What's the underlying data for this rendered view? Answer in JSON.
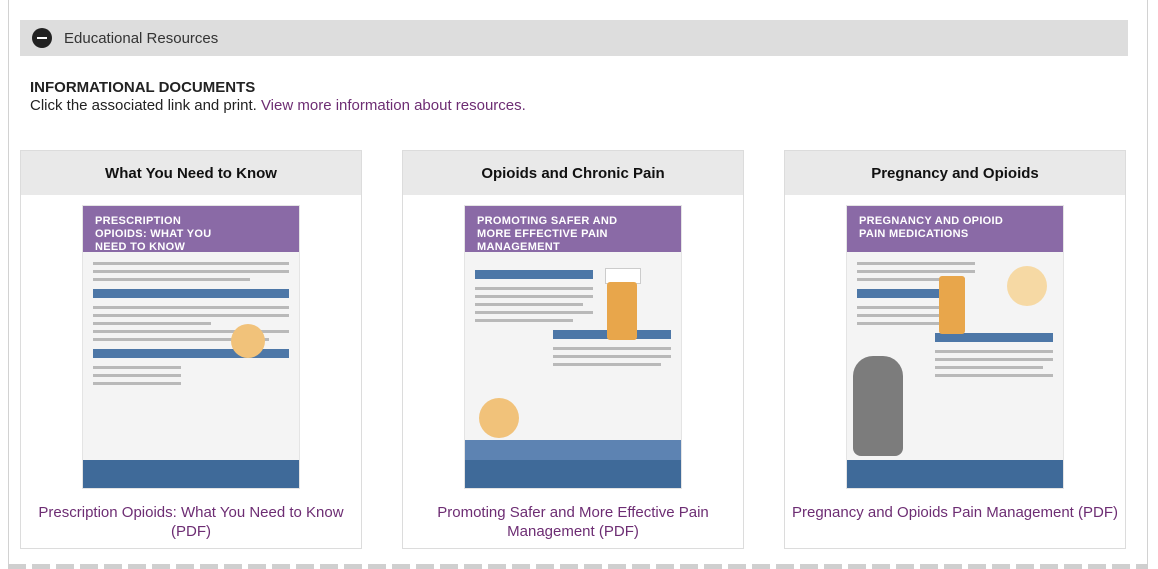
{
  "accordion": {
    "title": "Educational Resources"
  },
  "section": {
    "heading": "INFORMATIONAL DOCUMENTS",
    "intro_text": "Click the associated link and print.",
    "intro_link": "View more information about resources."
  },
  "cards": [
    {
      "header": "What You Need to Know",
      "thumb_title": "PRESCRIPTION OPIOIDS: WHAT YOU NEED TO KNOW",
      "link": "Prescription Opioids: What You Need to Know (PDF)"
    },
    {
      "header": "Opioids and Chronic Pain",
      "thumb_title": "PROMOTING SAFER AND MORE EFFECTIVE PAIN MANAGEMENT",
      "link": "Promoting Safer and More Effective Pain Management (PDF)"
    },
    {
      "header": "Pregnancy and Opioids",
      "thumb_title": "PREGNANCY AND OPIOID PAIN MEDICATIONS",
      "link": "Pregnancy and Opioids Pain Management (PDF)"
    }
  ],
  "colors": {
    "link": "#6d2d73",
    "accordion_bg": "#dddddd",
    "card_header_bg": "#e9e9e9",
    "banner_purple": "#8a6aa6"
  },
  "icons": {
    "accordion_toggle": "minus-circle-icon"
  }
}
